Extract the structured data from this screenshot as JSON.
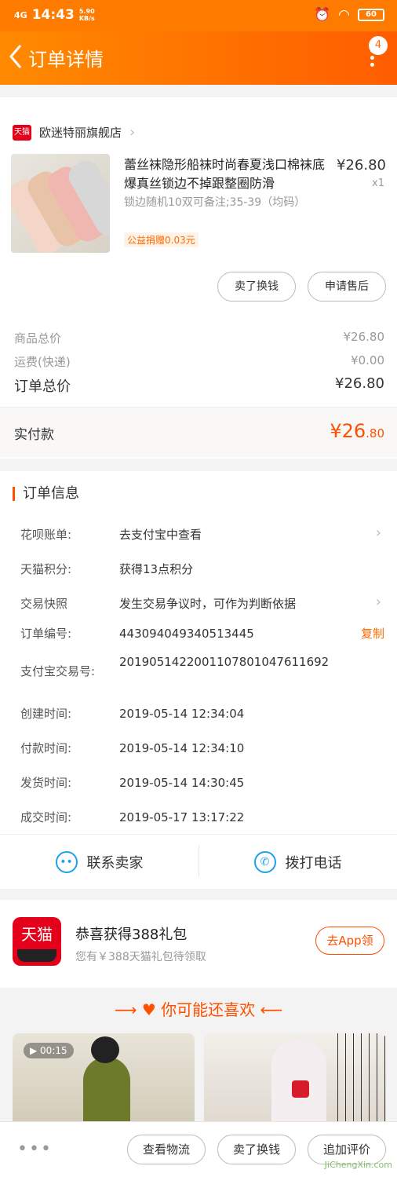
{
  "status": {
    "signal": "4G",
    "time": "14:43",
    "speed": "5.90\nKB/s",
    "battery": "60"
  },
  "nav": {
    "title": "订单详情",
    "badge": "4"
  },
  "shop": {
    "tag": "天猫",
    "name": "欧迷特丽旗舰店"
  },
  "product": {
    "title": "蕾丝袜隐形船袜时尚春夏浅口棉袜底爆真丝锁边不掉跟整圈防滑",
    "price": "¥26.80",
    "qty": "x1",
    "sku": "锁边随机10双可备注;35-39（均码）",
    "charity": "公益捐赠0.03元",
    "buttons": [
      "卖了换钱",
      "申请售后"
    ]
  },
  "totals": {
    "goods_label": "商品总价",
    "goods_value": "¥26.80",
    "shipping_label": "运费(快递)",
    "shipping_value": "¥0.00",
    "order_label": "订单总价",
    "order_value": "¥26.80",
    "paid_label": "实付款",
    "paid_int": "¥26",
    "paid_dec": ".80"
  },
  "order_info": {
    "title": "订单信息",
    "rows": [
      {
        "k": "花呗账单:",
        "v": "去支付宝中查看"
      },
      {
        "k": "天猫积分:",
        "v": "获得13点积分"
      },
      {
        "k": "交易快照",
        "v": "发生交易争议时，可作为判断依据"
      },
      {
        "k": "订单编号:",
        "v": "443094049340513445",
        "action": "复制"
      },
      {
        "k": "支付宝交易号:",
        "v": "2019051422001107801047611692"
      },
      {
        "k": "创建时间:",
        "v": "2019-05-14 12:34:04"
      },
      {
        "k": "付款时间:",
        "v": "2019-05-14 12:34:10"
      },
      {
        "k": "发货时间:",
        "v": "2019-05-14 14:30:45"
      },
      {
        "k": "成交时间:",
        "v": "2019-05-17 13:17:22"
      }
    ]
  },
  "contact": {
    "seller": "联系卖家",
    "phone": "拨打电话"
  },
  "gift": {
    "logo": "天猫",
    "title": "恭喜获得388礼包",
    "subtitle": "您有￥388天猫礼包待领取",
    "button": "去App领"
  },
  "recommend": {
    "title": "你可能还喜欢",
    "video_time": "00:15"
  },
  "bottom": {
    "dots": "•••",
    "buttons": [
      "查看物流",
      "卖了换钱",
      "追加评价"
    ],
    "watermark": "JiChengXin.com"
  }
}
